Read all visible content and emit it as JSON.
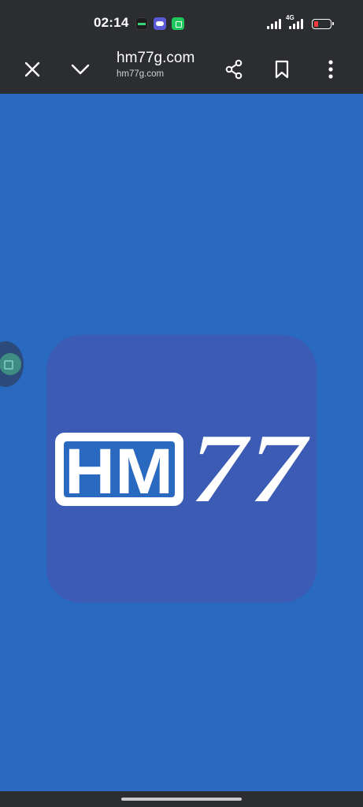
{
  "status_bar": {
    "time": "02:14",
    "network_label": "4G",
    "notification_icons": [
      "news-app-icon",
      "cloud-app-icon",
      "chat-app-icon"
    ],
    "battery_color": "#ff3b3b"
  },
  "toolbar": {
    "page_title": "hm77g.com",
    "page_url": "hm77g.com",
    "icons": [
      "close-icon",
      "chevron-down-icon",
      "share-icon",
      "bookmark-icon",
      "more-vert-icon"
    ]
  },
  "page": {
    "background_color": "#2a69c0",
    "logo": {
      "text_box": "HM",
      "text_outline": "77",
      "tile_color": "#3b5bb4"
    }
  }
}
